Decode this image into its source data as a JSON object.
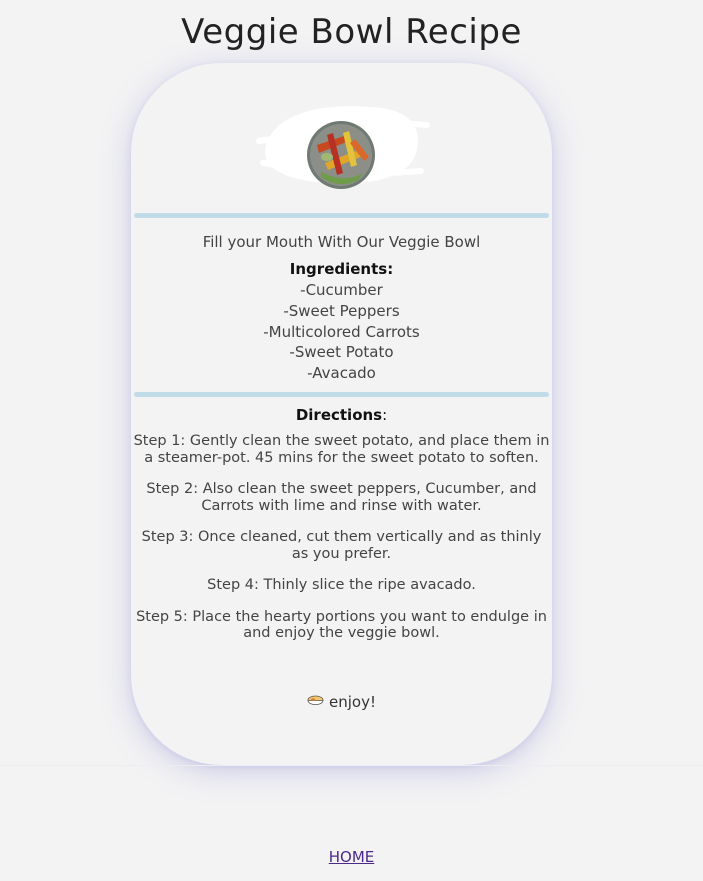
{
  "page": {
    "title": "Veggie Bowl Recipe"
  },
  "card": {
    "tagline": "Fill your Mouth With Our Veggie Bowl",
    "ingredients_heading": "Ingredients:",
    "ingredients": [
      "-Cucumber",
      "-Sweet Peppers",
      "-Multicolored Carrots",
      "-Sweet Potato",
      "-Avacado"
    ],
    "directions_heading": "Directions",
    "directions_colon": ":",
    "steps": [
      "Step 1: Gently clean the sweet potato, and place them in a steamer-pot. 45 mins for the sweet potato to soften.",
      "Step 2: Also clean the sweet peppers, Cucumber, and Carrots with lime and rinse with water.",
      "Step 3: Once cleaned, cut them vertically and as thinly as you prefer.",
      "Step 4: Thinly slice the ripe avacado.",
      "Step 5: Place the hearty portions you want to endulge in and enjoy the veggie bowl."
    ],
    "enjoy_text": "enjoy!",
    "enjoy_icon": "bowl-emoji-icon"
  },
  "footer": {
    "home_link": "HOME"
  }
}
